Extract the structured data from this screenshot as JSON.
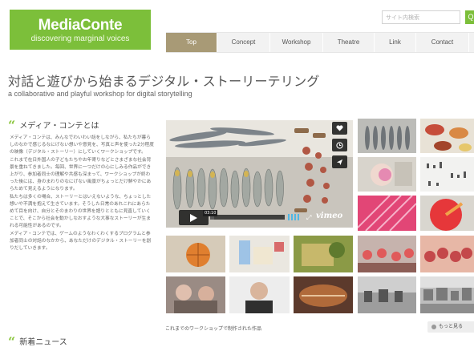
{
  "logo": {
    "title": "MediaConte",
    "subtitle": "discovering marginal voices"
  },
  "search": {
    "placeholder": "サイト内検索",
    "button_label": "Q"
  },
  "nav": {
    "tabs": [
      {
        "label": "Top",
        "active": true
      },
      {
        "label": "Concept",
        "active": false
      },
      {
        "label": "Workshop",
        "active": false
      },
      {
        "label": "Theatre",
        "active": false
      },
      {
        "label": "Link",
        "active": false
      },
      {
        "label": "Contact",
        "active": false
      }
    ]
  },
  "header": {
    "title": "対話と遊びから始まるデジタル・ストーリーテリング",
    "subtitle": "a collaborative and playful workshop for digital storytelling"
  },
  "about": {
    "heading": "メディア・コンテとは",
    "paragraphs": [
      "メディア・コンテは、みんなでわいわい話をしながら、私たちが暮らしのなかで感じるなにげない想いや意見を、写真と声を使った2分程度の映像（デジタル・ストーリー）にしていくワークショップです。",
      "これまで在日外国人の子どもたちやお年寄りなどとさまざまな社会背景を重ねてきました。毎回、世界に一つだけの心にしみる作品ができ上がり、参加者同士の理解や共感も深まって、ワークショップが終わった後には、身のまわりのなにげない風景がちょっとだけ鮮やかにあらためて見えるようになります。",
      "私たちは多くの場合、ストーリーとはいえないような、ちょっとした想いや不満を抱えて生きています。そうした日常のあれこれにあらためて目を向け、自分とそのまわりの世界を語りとともに見直していくことで、そこから社会を動かしなおすような大事なストーリーが生まれる可能性があるのです。",
      "メディア・コンテでは、ゲームのようなわくわくするプログラムと参加者同士の対話のなかから、あなただけのデジタル・ストーリーを創りだしていきます。"
    ]
  },
  "news": {
    "heading": "新着ニュース"
  },
  "video": {
    "time": "03:10",
    "brand": "vimeo",
    "progress_fraction": 0.05
  },
  "gallery": {
    "caption": "これまでのワークショップで制作された作品",
    "more_label": "もっと見る"
  },
  "colors": {
    "brand_green": "#7cbf3a",
    "nav_active": "#a89a76",
    "nav_bg": "#f2f2f2"
  },
  "icons": {
    "video_side": [
      "heart-icon",
      "clock-icon",
      "send-icon"
    ],
    "quote": "quote-icon",
    "more": "circle-icon"
  }
}
